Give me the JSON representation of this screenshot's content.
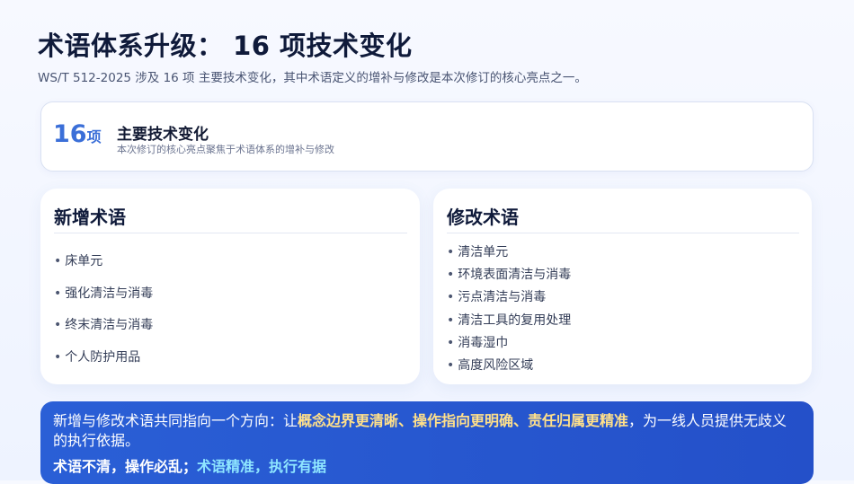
{
  "title": "术语体系升级： 16 项技术变化",
  "subtitle": "WS/T 512-2025  涉及  16 项 主要技术变化，其中术语定义的增补与修改是本次修订的核心亮点之一。",
  "summary": {
    "count_number": "16",
    "count_unit": "项",
    "heading": "主要技术变化",
    "description": "本次修订的核心亮点聚焦于术语体系的增补与修改"
  },
  "new_terms": {
    "title": "新增术语",
    "items": [
      "床单元",
      "强化清洁与消毒",
      "终末清洁与消毒",
      "个人防护用品"
    ]
  },
  "modified_terms": {
    "title": "修改术语",
    "items": [
      "清洁单元",
      "环境表面清洁与消毒",
      "污点清洁与消毒",
      "清洁工具的复用处理",
      "消毒湿巾",
      "高度风险区域"
    ]
  },
  "banner": {
    "prefix": "新增与修改术语共同指向一个方向：让",
    "highlight": "概念边界更清晰、操作指向更明确、责任归属更精准",
    "suffix": "，为一线人员提供无歧义的执行依据。",
    "slogan_a": "术语不清，操作必乱；",
    "slogan_b": "术语精准，执行有据"
  },
  "colors": {
    "accent": "#3b6fd8",
    "banner_bg": "#2a5fd6",
    "highlight_yellow": "#ffe08a",
    "highlight_cyan": "#8fe6ff"
  }
}
